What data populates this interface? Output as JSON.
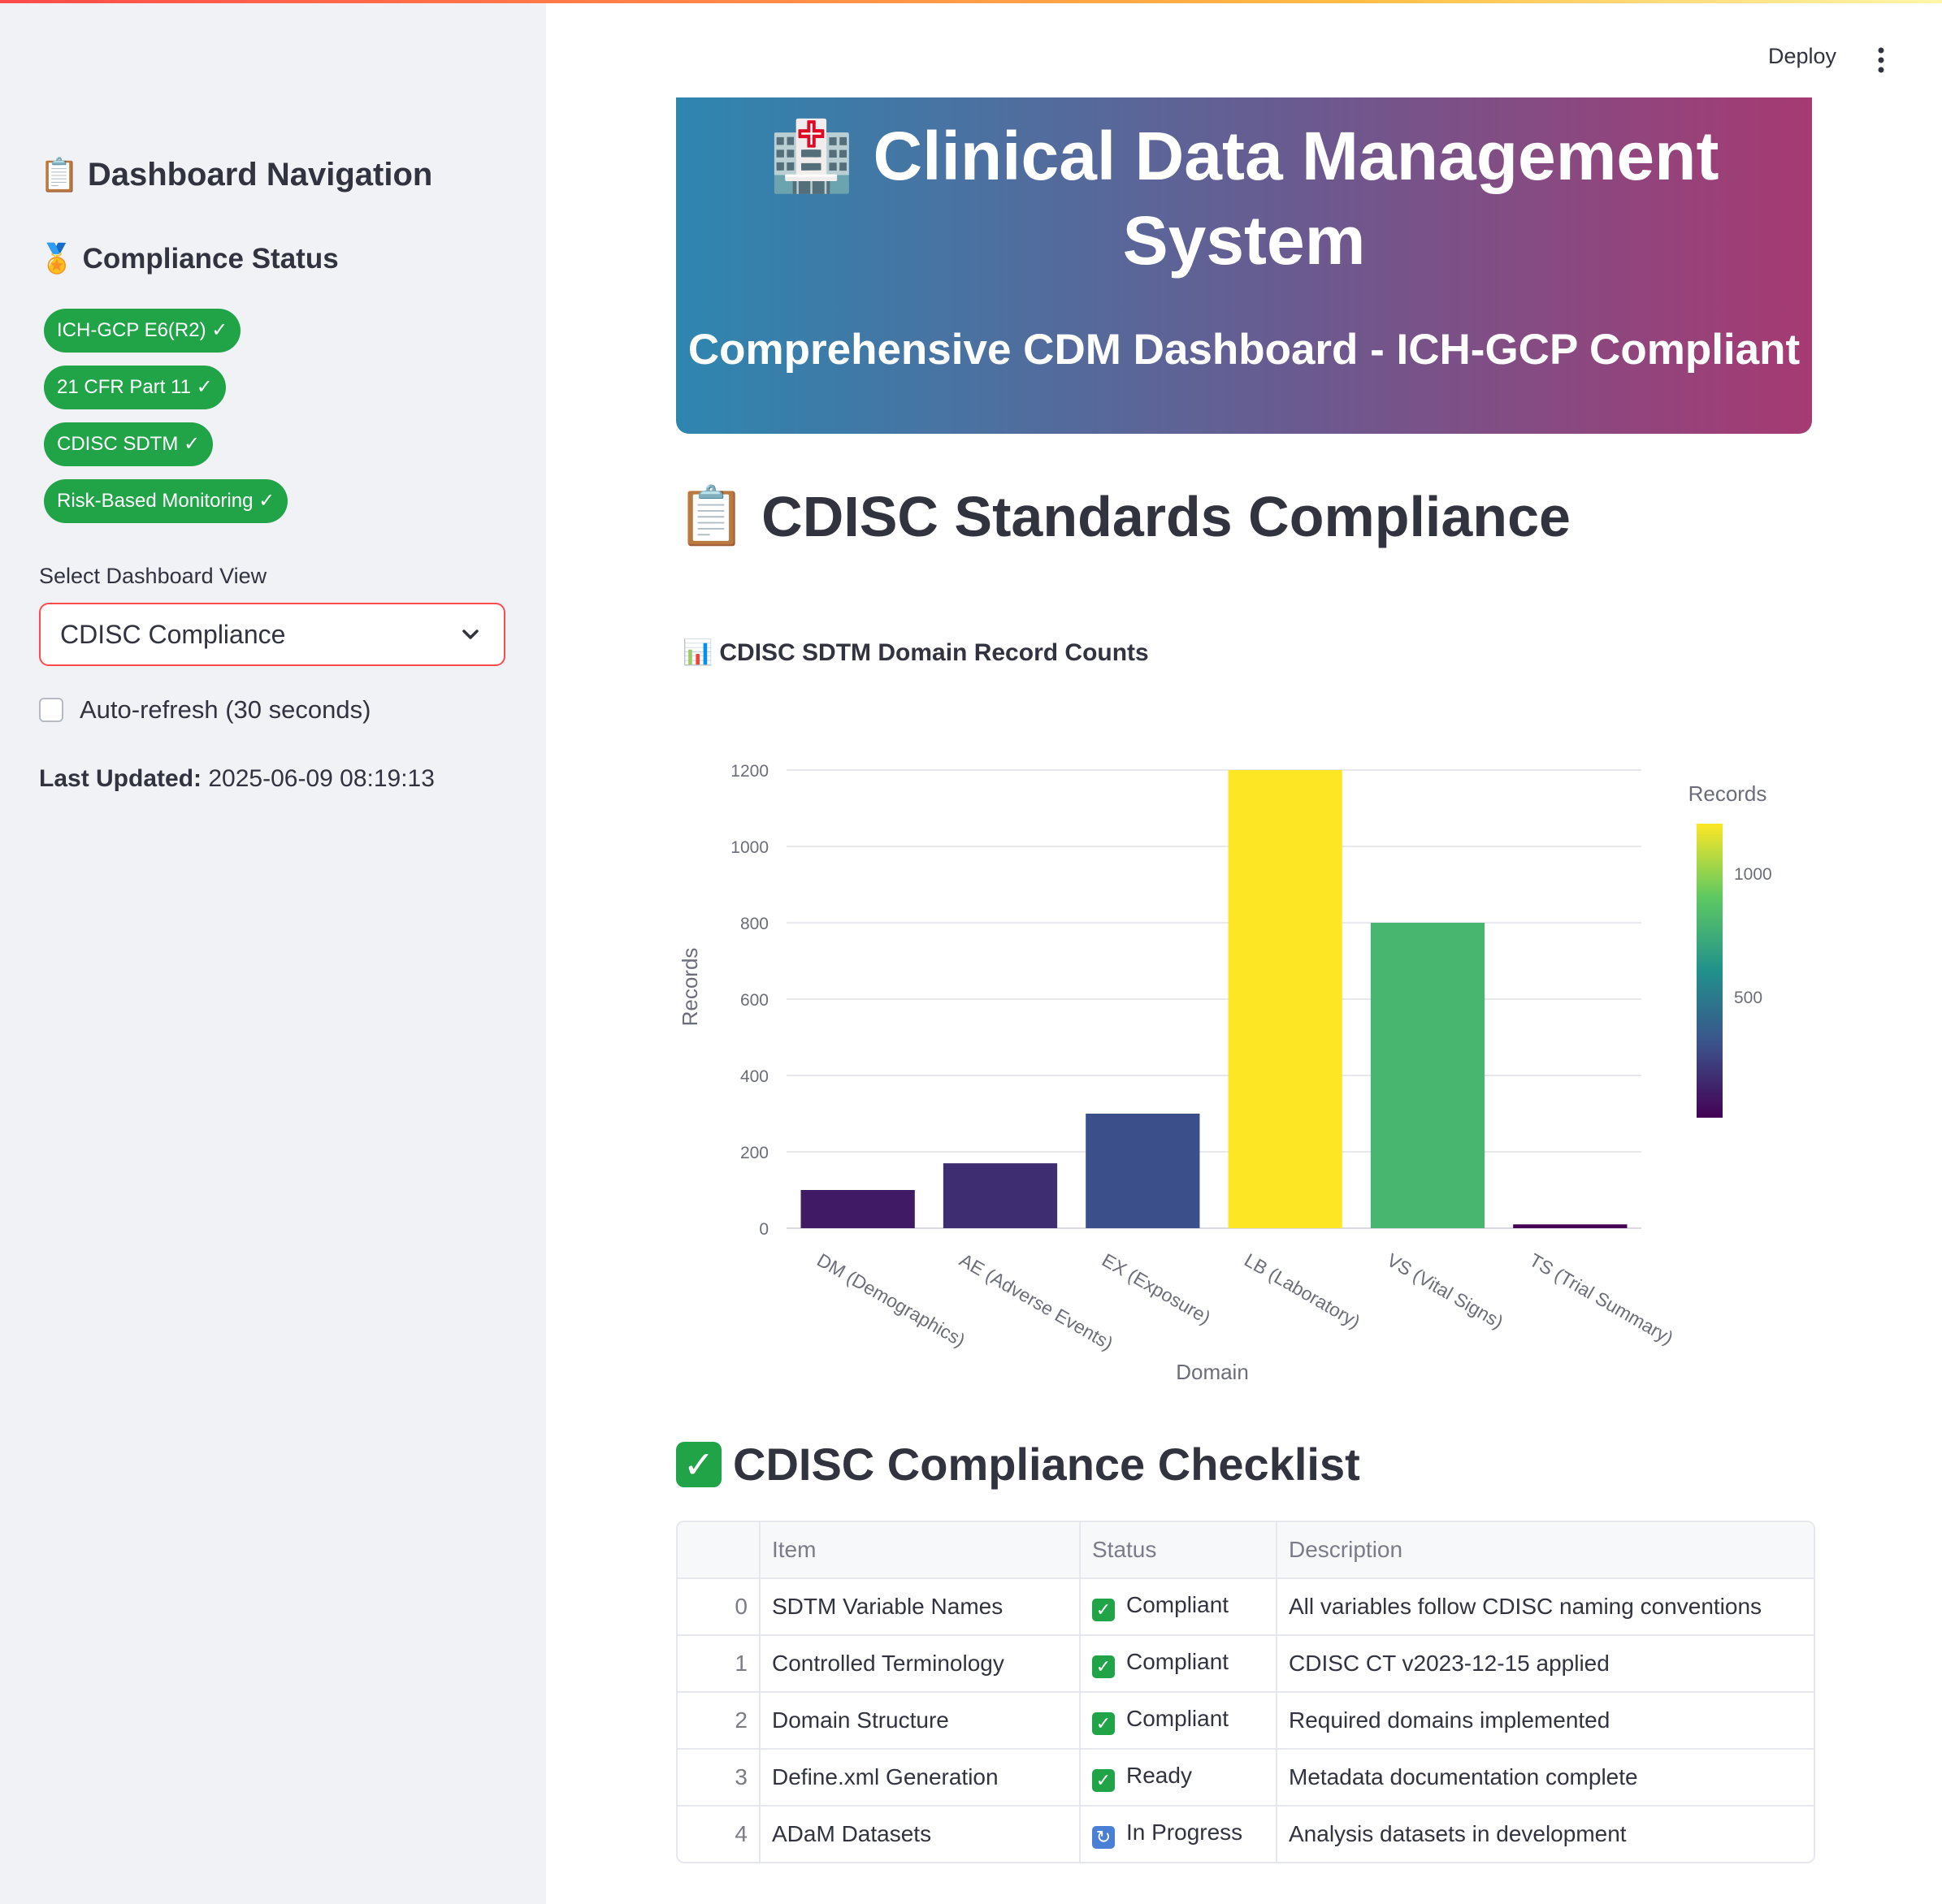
{
  "header": {
    "deploy_label": "Deploy",
    "menu_icon": "kebab-menu-icon"
  },
  "sidebar": {
    "title": "Dashboard Navigation",
    "title_icon": "📋",
    "compliance_title": "Compliance Status",
    "compliance_icon": "🏅",
    "badges": [
      "ICH-GCP E6(R2) ✓",
      "21 CFR Part 11 ✓",
      "CDISC SDTM ✓",
      "Risk-Based Monitoring ✓"
    ],
    "select_label": "Select Dashboard View",
    "select_value": "CDISC Compliance",
    "autorefresh_label": "Auto-refresh (30 seconds)",
    "autorefresh_checked": false,
    "last_updated_label": "Last Updated:",
    "last_updated_value": "2025-06-09 08:19:13"
  },
  "hero": {
    "icon": "🏥",
    "title": "Clinical Data Management System",
    "subtitle": "Comprehensive CDM Dashboard - ICH-GCP Compliant"
  },
  "section": {
    "icon": "📋",
    "title": "CDISC Standards Compliance"
  },
  "chart_title": "CDISC SDTM Domain Record Counts",
  "chart_title_icon": "📊",
  "chart_data": {
    "type": "bar",
    "categories": [
      "DM (Demographics)",
      "AE (Adverse Events)",
      "EX (Exposure)",
      "LB (Laboratory)",
      "VS (Vital Signs)",
      "TS (Trial Summary)"
    ],
    "values": [
      100,
      170,
      300,
      1200,
      800,
      10
    ],
    "xlabel": "Domain",
    "ylabel": "Records",
    "ylim": [
      0,
      1200
    ],
    "yticks": [
      0,
      200,
      400,
      600,
      800,
      1000,
      1200
    ],
    "colorbar": {
      "title": "Records",
      "ticks": [
        500,
        1000
      ],
      "colorscale": "viridis"
    },
    "grid": true
  },
  "checklist": {
    "icon": "✅",
    "title": "CDISC Compliance Checklist",
    "columns": [
      "",
      "Item",
      "Status",
      "Description"
    ],
    "rows": [
      {
        "index": "0",
        "item": "SDTM Variable Names",
        "status_icon": "✅",
        "status": "Compliant",
        "description": "All variables follow CDISC naming conventions"
      },
      {
        "index": "1",
        "item": "Controlled Terminology",
        "status_icon": "✅",
        "status": "Compliant",
        "description": "CDISC CT v2023-12-15 applied"
      },
      {
        "index": "2",
        "item": "Domain Structure",
        "status_icon": "✅",
        "status": "Compliant",
        "description": "Required domains implemented"
      },
      {
        "index": "3",
        "item": "Define.xml Generation",
        "status_icon": "✅",
        "status": "Ready",
        "description": "Metadata documentation complete"
      },
      {
        "index": "4",
        "item": "ADaM Datasets",
        "status_icon": "🔄",
        "status": "In Progress",
        "description": "Analysis datasets in development"
      }
    ]
  }
}
